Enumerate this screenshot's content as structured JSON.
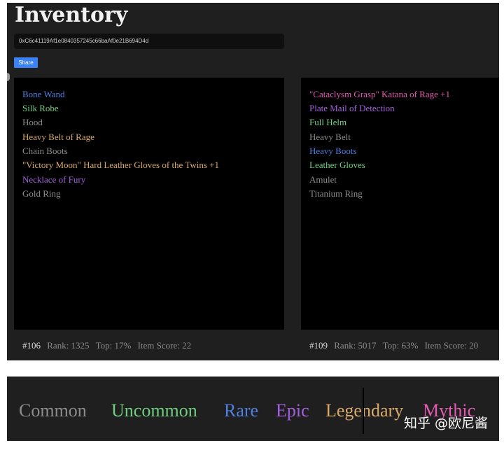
{
  "header": {
    "title": "Inventory",
    "address": "0xC6c41119Af1e0840357245c66baAf0e21B694D4d",
    "share_label": "Share"
  },
  "colors": {
    "common": "#8c8c8c",
    "uncommon": "#6fcf7f",
    "rare": "#4f7fe0",
    "epic": "#a65fe0",
    "legendary": "#d9a96a",
    "mythic": "#e35ab0"
  },
  "left_bag": {
    "items": [
      {
        "name": "Bone Wand",
        "rarity": "rare"
      },
      {
        "name": "Silk Robe",
        "rarity": "uncommon"
      },
      {
        "name": "Hood",
        "rarity": "common"
      },
      {
        "name": "Heavy Belt of Rage",
        "rarity": "legendary"
      },
      {
        "name": "Chain Boots",
        "rarity": "common"
      },
      {
        "name": "\"Victory Moon\" Hard Leather Gloves of the Twins +1",
        "rarity": "legendary"
      },
      {
        "name": "Necklace of Fury",
        "rarity": "epic"
      },
      {
        "name": "Gold Ring",
        "rarity": "common"
      }
    ],
    "stats": {
      "id": "#106",
      "rank": "Rank: 1325",
      "top": "Top: 17%",
      "score": "Item Score: 22"
    }
  },
  "right_bag": {
    "items": [
      {
        "name": "\"Cataclysm Grasp\" Katana of Rage +1",
        "rarity": "mythic"
      },
      {
        "name": "Plate Mail of Detection",
        "rarity": "epic"
      },
      {
        "name": "Full Helm",
        "rarity": "uncommon"
      },
      {
        "name": "Heavy Belt",
        "rarity": "common"
      },
      {
        "name": "Heavy Boots",
        "rarity": "rare"
      },
      {
        "name": "Leather Gloves",
        "rarity": "uncommon"
      },
      {
        "name": "Amulet",
        "rarity": "common"
      },
      {
        "name": "Titanium Ring",
        "rarity": "common"
      }
    ],
    "stats": {
      "id": "#109",
      "rank": "Rank: 5017",
      "top": "Top: 63%",
      "score": "Item Score: 20"
    }
  },
  "legend": [
    {
      "label": "Common",
      "rarity": "common"
    },
    {
      "label": "Uncommon",
      "rarity": "uncommon"
    },
    {
      "label": "Rare",
      "rarity": "rare"
    },
    {
      "label": "Epic",
      "rarity": "epic"
    },
    {
      "label": "Legendary",
      "rarity": "legendary"
    },
    {
      "label": "Mythic",
      "rarity": "mythic"
    }
  ],
  "watermark": "知乎 @欧尼酱"
}
